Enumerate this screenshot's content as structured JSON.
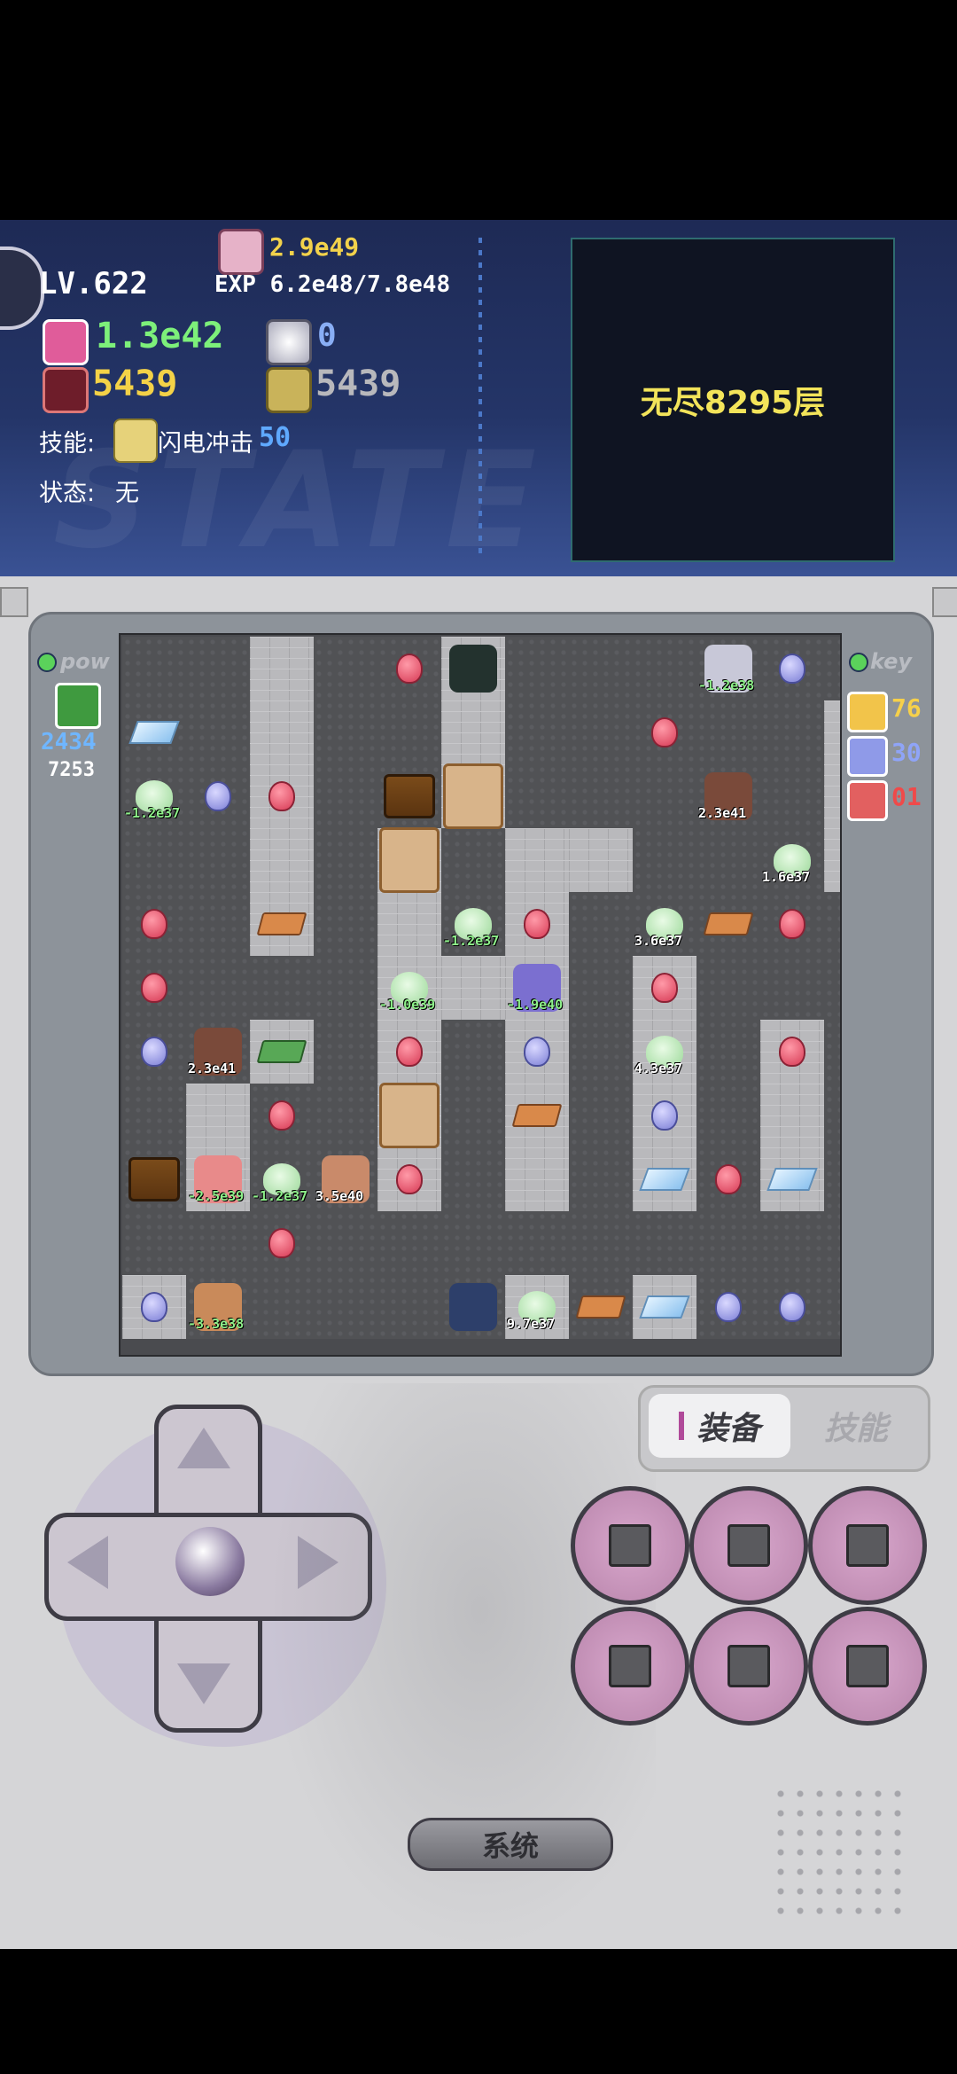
{
  "hud": {
    "level": "LV.622",
    "gold": "2.9e49",
    "exp": "EXP 6.2e48/7.8e48",
    "hp": "1.3e42",
    "mdef": "0",
    "atk": "5439",
    "def": "5439",
    "skill_label": "技能:",
    "skill_name": "闪电冲击",
    "skill_cost": "50",
    "state_label": "状态:",
    "state_value": "无",
    "bg_word": "STATE",
    "floor": "无尽8295层"
  },
  "left_panel": {
    "title": "pow",
    "value1": "2434",
    "value2": "7253"
  },
  "right_panel": {
    "title": "key",
    "keys": [
      {
        "color": "#f2c44a",
        "count": "76",
        "count_color": "#f6d04a"
      },
      {
        "color": "#8f9ae8",
        "count": "30",
        "count_color": "#8fa4f7"
      },
      {
        "color": "#e26060",
        "count": "01",
        "count_color": "#ef4a4a"
      }
    ]
  },
  "map": {
    "walls": [
      "..W..W.........",
      "..W..W.....W...",
      "..W..W.....W...",
      "..W.W.WW...W.W.",
      "..W.W.W......W.",
      "....WWW.W......",
      "..W.W.W.W.W.W..",
      ".W..W.W.W.W.W..",
      ".W..W.W.W.W....",
      "...............",
      "W.....W.W......"
    ],
    "labels": [
      {
        "text": "-1.2e38",
        "green": true
      },
      {
        "text": "-1.2e37",
        "green": true
      },
      {
        "text": "2.3e41",
        "green": false
      },
      {
        "text": "1.6e37",
        "green": false
      },
      {
        "text": "-1.2e37",
        "green": true
      },
      {
        "text": "3.6e37",
        "green": false
      },
      {
        "text": "-1.9e40",
        "green": true
      },
      {
        "text": "-1.0e39",
        "green": true
      },
      {
        "text": "2.3e41",
        "green": false
      },
      {
        "text": "4.3e37",
        "green": false
      },
      {
        "text": "-2.5e39",
        "green": true
      },
      {
        "text": "-1.2e37",
        "green": true
      },
      {
        "text": "3.5e40",
        "green": false
      },
      {
        "text": "-3.3e38",
        "green": true
      },
      {
        "text": "9.7e37",
        "green": false
      }
    ]
  },
  "controls": {
    "tab_equip": "装备",
    "tab_skill": "技能",
    "system": "系统"
  }
}
